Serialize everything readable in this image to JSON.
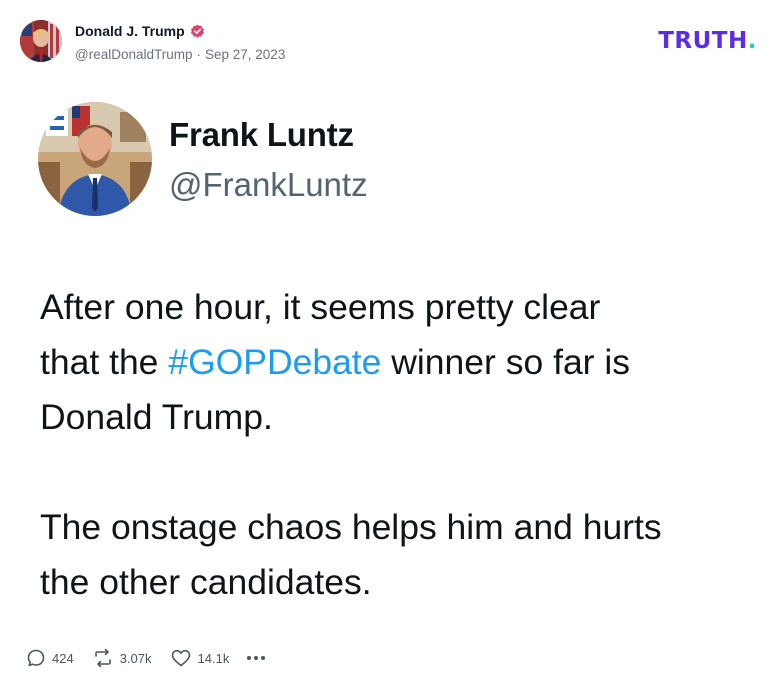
{
  "post": {
    "author_name": "Donald J. Trump",
    "handle": "@realDonaldTrump",
    "separator": "·",
    "date": "Sep 27, 2023",
    "verified_icon": "verified-badge-icon"
  },
  "brand": {
    "logo_text": "TRUTH",
    "logo_dot": ".",
    "logo_color": "#5b2ee6",
    "logo_dot_color": "#20d0b8"
  },
  "embedded_tweet": {
    "name": "Frank Luntz",
    "handle": "@FrankLuntz",
    "line1": "After one hour, it seems pretty clear",
    "line2_before": "that the ",
    "line2_hashtag": "#GOPDebate",
    "line2_after": " winner so far is",
    "line3": "Donald Trump.",
    "line4": "The onstage chaos helps him and hurts",
    "line5": "the other candidates.",
    "hashtag_color": "#1d9bf0"
  },
  "stats": {
    "replies": "424",
    "reposts": "3.07k",
    "likes": "14.1k",
    "reply_icon": "reply-icon",
    "repost_icon": "repost-icon",
    "like_icon": "heart-icon",
    "more_icon": "more-options-icon"
  }
}
